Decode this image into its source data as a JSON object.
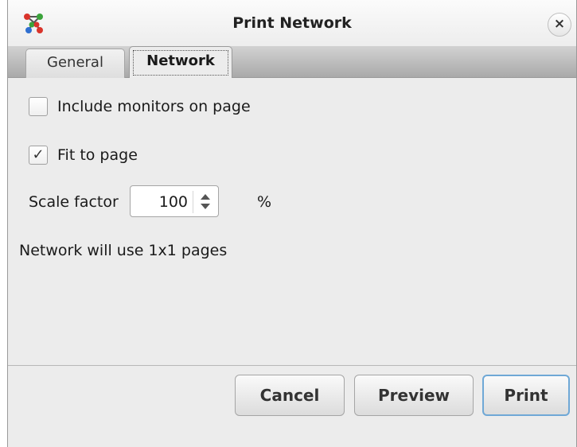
{
  "window": {
    "title": "Print Network",
    "close_label": "×",
    "app_icon": "network-nodes-icon"
  },
  "tabs": [
    {
      "label": "General",
      "active": false
    },
    {
      "label": "Network",
      "active": true
    }
  ],
  "options": {
    "include_monitors": {
      "label": "Include monitors on page",
      "checked": false
    },
    "fit_to_page": {
      "label": "Fit to page",
      "checked": true,
      "check_glyph": "✓"
    }
  },
  "scale": {
    "label": "Scale factor",
    "value": "100",
    "unit": "%"
  },
  "info_text": "Network will use 1x1 pages",
  "buttons": {
    "cancel": "Cancel",
    "preview": "Preview",
    "print": "Print"
  },
  "colors": {
    "default_button_border": "#6fa8d6",
    "icon_red": "#d9342b",
    "icon_green": "#3aa33a",
    "icon_blue": "#2f6fd0"
  }
}
